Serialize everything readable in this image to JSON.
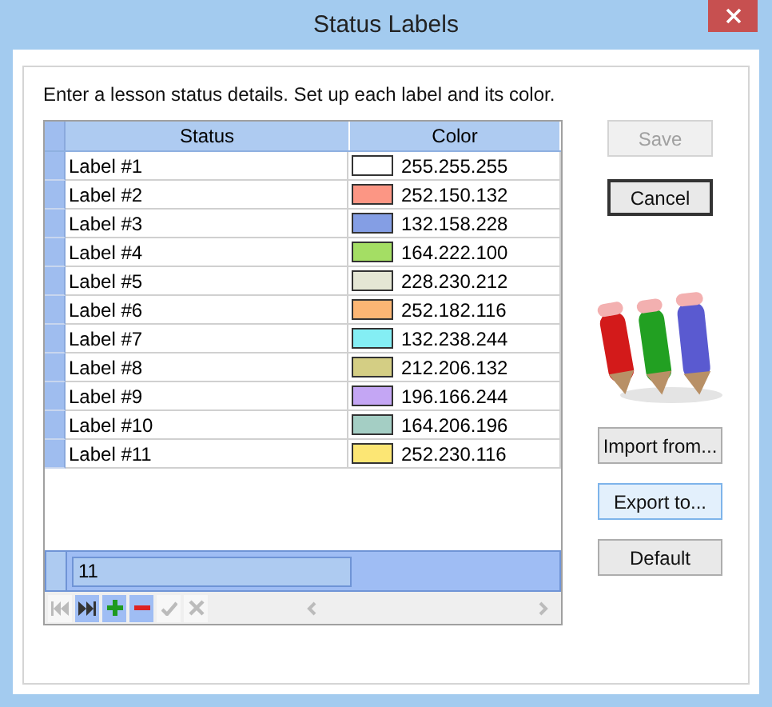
{
  "window": {
    "title": "Status Labels"
  },
  "instructions": "Enter a lesson status details. Set up each label and its color.",
  "table": {
    "columns": [
      "Status",
      "Color"
    ],
    "rows": [
      {
        "status": "Label #1",
        "color": "#ffffff",
        "color_text": "255.255.255"
      },
      {
        "status": "Label #2",
        "color": "#fc9684",
        "color_text": "252.150.132"
      },
      {
        "status": "Label #3",
        "color": "#849ee4",
        "color_text": "132.158.228"
      },
      {
        "status": "Label #4",
        "color": "#a4de64",
        "color_text": "164.222.100"
      },
      {
        "status": "Label #5",
        "color": "#e4e6d4",
        "color_text": "228.230.212"
      },
      {
        "status": "Label #6",
        "color": "#fcb674",
        "color_text": "252.182.116"
      },
      {
        "status": "Label #7",
        "color": "#84eef4",
        "color_text": "132.238.244"
      },
      {
        "status": "Label #8",
        "color": "#d4ce84",
        "color_text": "212.206.132"
      },
      {
        "status": "Label #9",
        "color": "#c4a6f4",
        "color_text": "196.166.244"
      },
      {
        "status": "Label #10",
        "color": "#a4cec4",
        "color_text": "164.206.196"
      },
      {
        "status": "Label #11",
        "color": "#fce674",
        "color_text": "252.230.116"
      }
    ],
    "footer_count": "11",
    "navigator": [
      {
        "kind": "first",
        "disabled": true
      },
      {
        "kind": "last",
        "disabled": false
      },
      {
        "kind": "add",
        "disabled": false
      },
      {
        "kind": "delete",
        "disabled": false
      },
      {
        "kind": "post",
        "disabled": true
      },
      {
        "kind": "cancel",
        "disabled": true
      }
    ]
  },
  "side_buttons": [
    {
      "label": "Save",
      "disabled": true,
      "focused": false,
      "hovered": false
    },
    {
      "label": "Cancel",
      "disabled": false,
      "focused": true,
      "hovered": false
    }
  ],
  "lower_buttons": [
    {
      "label": "Import from...",
      "disabled": false,
      "focused": false,
      "hovered": false
    },
    {
      "label": "Export to...",
      "disabled": false,
      "focused": false,
      "hovered": true
    },
    {
      "label": "Default",
      "disabled": false,
      "focused": false,
      "hovered": false
    }
  ]
}
